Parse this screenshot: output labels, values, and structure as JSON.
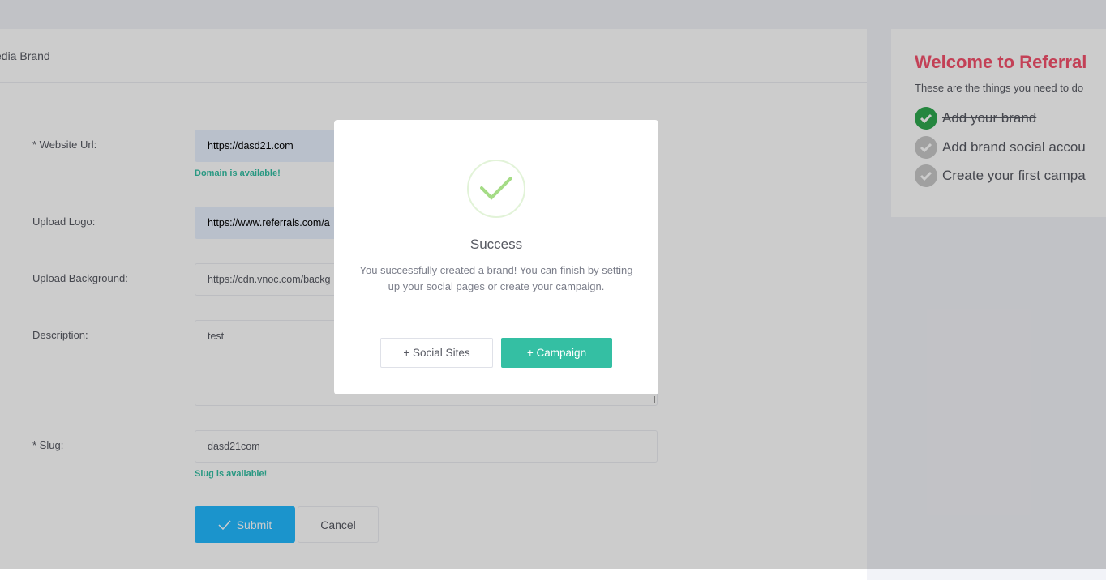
{
  "page": {
    "card_title": "edia Brand"
  },
  "form": {
    "website_label": "* Website Url:",
    "website_value": "https://dasd21.com",
    "website_hint": "Domain is available!",
    "logo_label": "Upload Logo:",
    "logo_value": "https://www.referrals.com/a",
    "background_label": "Upload Background:",
    "background_value": "https://cdn.vnoc.com/backg",
    "description_label": "Description:",
    "description_value": "test",
    "slug_label": "* Slug:",
    "slug_value": "dasd21com",
    "slug_hint": "Slug is available!",
    "submit_label": "Submit",
    "cancel_label": "Cancel"
  },
  "sidebar": {
    "title": "Welcome to Referral",
    "subtitle": "These are the things you need to do",
    "steps": [
      {
        "label": "Add your brand",
        "done": true
      },
      {
        "label": "Add brand social accou",
        "done": false
      },
      {
        "label": "Create your first campa",
        "done": false
      }
    ]
  },
  "modal": {
    "title": "Success",
    "message": "You successfully created a brand! You can finish by setting up your social pages or create your campaign.",
    "social_button": "+ Social Sites",
    "campaign_button": "+ Campaign"
  },
  "colors": {
    "accent_green": "#34bfa3",
    "brand_red": "#f4516c",
    "submit_blue": "#22b9ff"
  }
}
